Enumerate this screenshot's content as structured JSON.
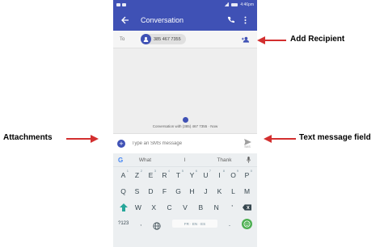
{
  "statusbar": {
    "time": "4:46pm"
  },
  "toolbar": {
    "title": "Conversation"
  },
  "to_row": {
    "label": "To",
    "recipient": "385 467 7355"
  },
  "conversation": {
    "info": "Conversation with (385) 467 7355 · Now"
  },
  "compose": {
    "placeholder": "Type an SMS message",
    "send_label": "SMS"
  },
  "keyboard": {
    "suggestions": [
      "What",
      "I",
      "Thank"
    ],
    "row1": [
      {
        "k": "A",
        "n": "1"
      },
      {
        "k": "Z",
        "n": "2"
      },
      {
        "k": "E",
        "n": "3"
      },
      {
        "k": "R",
        "n": "4"
      },
      {
        "k": "T",
        "n": "5"
      },
      {
        "k": "Y",
        "n": "6"
      },
      {
        "k": "U",
        "n": "7"
      },
      {
        "k": "I",
        "n": "8"
      },
      {
        "k": "O",
        "n": "9"
      },
      {
        "k": "P",
        "n": "0"
      }
    ],
    "row2": [
      "Q",
      "S",
      "D",
      "F",
      "G",
      "H",
      "J",
      "K",
      "L",
      "M"
    ],
    "row3": [
      "W",
      "X",
      "C",
      "V",
      "B",
      "N",
      "'"
    ],
    "sym_label": "?123",
    "comma": ",",
    "space_label": "FR · EN · ES",
    "period": "."
  },
  "callouts": {
    "add_recipient": "Add Recipient",
    "attachments": "Attachments",
    "text_field": "Text message field"
  },
  "colors": {
    "primary": "#3f51b5",
    "arrow": "#d32f2f",
    "enter": "#4caf50"
  }
}
